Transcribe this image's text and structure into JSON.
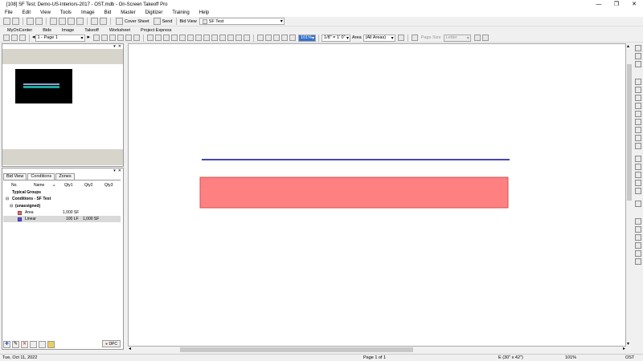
{
  "window": {
    "title": "[108] SF Test; Demo-US-Interiors-2017 - OST.mdb - On-Screen Takeoff Pro",
    "controls": [
      "—",
      "❐",
      "✕"
    ]
  },
  "menu": [
    "File",
    "Edit",
    "View",
    "Tools",
    "Image",
    "Bid",
    "Master",
    "Digitizer",
    "Training",
    "Help"
  ],
  "toolbar1": {
    "cover_sheet": "Cover Sheet",
    "send": "Send",
    "bid_view_label": "Bid View",
    "bid_view_value": "SF Test"
  },
  "tabs": [
    "MyOnCenter",
    "Bids",
    "Image",
    "Takeoff",
    "Worksheet",
    "Project Express"
  ],
  "toolbar2": {
    "page_combo": "1 - Page 1",
    "zoom": "101%",
    "scale": "1/8\" = 1' 0\"",
    "area_label": "Area",
    "area_value": "(All Areas)",
    "page_size_label": "Page Size",
    "page_size_value": "Letter"
  },
  "conditions_panel": {
    "tabs": [
      "Bid View",
      "Conditions",
      "Zones"
    ],
    "columns": [
      "No.",
      "Name",
      "Qty1",
      "Qty2",
      "Qty3"
    ],
    "groups": {
      "typical": "Typical Groups",
      "conditions": "Conditions - SF Test",
      "unassigned": "(unassigned)"
    },
    "rows": [
      {
        "name": "Area",
        "qty1": "1,000 SF",
        "qty2": "",
        "color": "#e07070"
      },
      {
        "name": "Linear",
        "qty1": "100 LF",
        "qty2": "1,000 SF",
        "color": "#5555cc"
      }
    ],
    "footer_button": "DPC"
  },
  "canvas": {
    "line_color": "#4545bb",
    "area_color": "#ff8080",
    "area_border": "#d05050"
  },
  "status": {
    "date": "Tue, Oct 11, 2022",
    "page": "Page 1 of 1",
    "sheet": "E (30\" x 42\")",
    "zoom": "101%",
    "app": "OST"
  }
}
